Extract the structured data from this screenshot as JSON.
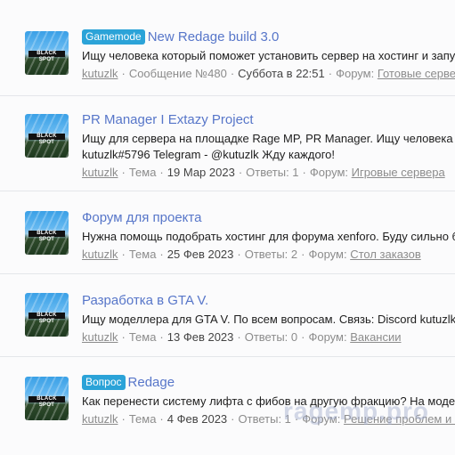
{
  "avatar_text": "BLACK SPOT",
  "results": [
    {
      "badge": "Gamemode",
      "title": "New Redage build 3.0",
      "snippet": "Ищу человека который поможет установить сервер на хостинг и запу",
      "author": "kutuzlk",
      "type": "Сообщение №480",
      "date": "Суббота в 22:51",
      "replies": "",
      "forum_label": "Форум:",
      "forum": "Готовые сервера"
    },
    {
      "badge": "",
      "title": "PR Manager I Extazy Project",
      "snippet": "Ищу для сервера на площадке Rage MP, PR Manager. Ищу человека к",
      "snippet2": "kutuzlk#5796 Telegram - @kutuzlk Жду каждого!",
      "author": "kutuzlk",
      "type": "Тема",
      "date": "19 Мар 2023",
      "replies": "Ответы: 1",
      "forum_label": "Форум:",
      "forum": "Игровые сервера"
    },
    {
      "badge": "",
      "title": "Форум для проекта",
      "snippet": "Нужна помощь подобрать хостинг для форума xenforo. Буду сильно б",
      "author": "kutuzlk",
      "type": "Тема",
      "date": "25 Фев 2023",
      "replies": "Ответы: 2",
      "forum_label": "Форум:",
      "forum": "Стол заказов"
    },
    {
      "badge": "",
      "title": "Разработка в GTA V.",
      "snippet": "Ищу моделлера для GTA V. По всем вопросам. Связь: Discord kutuzlk",
      "author": "kutuzlk",
      "type": "Тема",
      "date": "13 Фев 2023",
      "replies": "Ответы: 0",
      "forum_label": "Форум:",
      "forum": "Вакансии"
    },
    {
      "badge": "Вопрос",
      "title": "Redage",
      "snippet": "Как перенести систему лифта с фибов на другую фракцию? На моде",
      "author": "kutuzlk",
      "type": "Тема",
      "date": "4 Фев 2023",
      "replies": "Ответы: 1",
      "forum_label": "Форум:",
      "forum": "Решение проблем и п"
    }
  ],
  "watermark": "ragemp.pro"
}
